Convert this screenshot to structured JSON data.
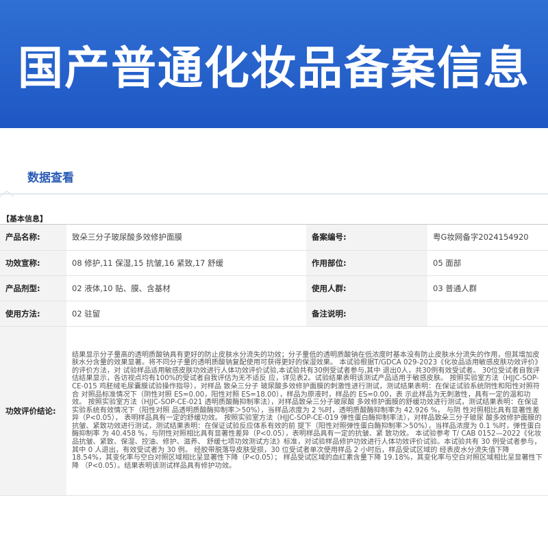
{
  "banner": {
    "title": "国产普通化妆品备案信息"
  },
  "tab": {
    "label": "数据查看"
  },
  "section": {
    "title": "【基本信息】"
  },
  "rows": [
    {
      "label1": "产品名称:",
      "value1": "致朵三分子玻尿酸多效修护面膜",
      "label2": "备案编号:",
      "value2": "粤G妆网备字2024154920"
    },
    {
      "label1": "功效宣称:",
      "value1": "08 修护,11 保湿,15 抗皱,16 紧致,17 舒缓",
      "label2": "作用部位:",
      "value2": "05 面部"
    },
    {
      "label1": "产品剂型:",
      "value1": "02 液体,10 贴、膜、含基材",
      "label2": "使用人群:",
      "value2": "03 普通人群"
    },
    {
      "label1": "使用方法:",
      "value1": "02 驻留",
      "label2": "备注说明:",
      "value2": ""
    }
  ],
  "efficacy": {
    "label": "功效评价结论:",
    "text": "结果显示分子量高的透明质酸钠具有更好的防止皮肤水分流失的功效；分子量低的透明质酸钠在低浓度时基本没有防止皮肤水分流失的作用，但其增加皮肤水分含量的效果显著。将不同分子量的透明质酸钠复配使用可获得更好的保湿效果。 本试验根据T/GDCA 029-2023《化妆品适用敏感皮肤功效评价》的评价方法，对 试验样品适用敏感皮肤功效进行人体功效评价试验,本试验共有30例受试者参与,其中 退出0人，共30例有效受试者。 30位受试者自我评估结果显示，各访视点均有100%的受试者自我评估为无不适反 应，详见表2。试验结果表明该测试产品适用于敏感皮肤。 按照实验室方法（HJJC-SOP-CE-015 鸡胚绒毛尿囊膜试验操作指导），对样品 致朵三分子 玻尿酸多效修护面膜的刺激性进行测试，测试结果表明：在保证试验系统阴性和阳性对照符合 对照品标准情况下（阴性对照 ES=0.00，阳性对照 ES=18.00），样品为原液时，样品的 ES=0.00，表 示此样品为无刺激性，具有一定的温和功效。 按照实验室方法（HJJC-SOP-CE-021 透明质酸酶抑制率法），对样品致朵三分子玻尿酸 多效修护面膜的舒缓功效进行测试，测试结果表明：在保证实验系统有效情况下（阳性对照 品透明质酸酶抑制率＞50%），当样品浓度为 2 %时，透明质酸酶抑制率为 42.926 %， 与阴 性对照相比具有显著性差异（P<0.05）， 表明样品具有一定的舒缓功效。 按照实验室方法（HJJC-SOP-CE-019 弹性蛋白酶抑制率法），对样品致朵三分子玻尿 酸多效修护面膜的抗皱、紧致功效进行测试，测试结果表明：在保证试验反应体系有效的前 提下（阳性对照弹性蛋白酶抑制率＞50%），当样品浓度为 0.1 %时，弹性蛋白酶抑制率 为 40.458 %，与阴性对照相比具有显著性差异（P<0.05），表明样品具有一定的抗皱、紧 致功效。 本试验参考 T/ CAB 0152—2022《化妆品抗皱、紧致、保湿、控油、修护、滋养、 舒缓七项功效测试方法》标准，对试验样品修护功效进行人体功效评价试验。本试验共有 30 例受试者参与，其中 0 人退出，有效受试者为 30 例。 经胶带脱落导皮肤受损，30 位受试者单次使用样品 2 小时后，样品受试区域的 经表皮水分流失值下降 18.54%，其变化率与空白对照区域相比呈显著性下降（P<0.05）； 样品受试区域的血红素含量下降 19.18%，其变化率与空白对照区域相比呈显著性下降 （P<0.05）。结果表明该测试样品具有修护功效。"
  },
  "colors": {
    "banner": "#1f57c4",
    "tab_text": "#2a5bb5",
    "label_bg": "#f3f3f3"
  }
}
